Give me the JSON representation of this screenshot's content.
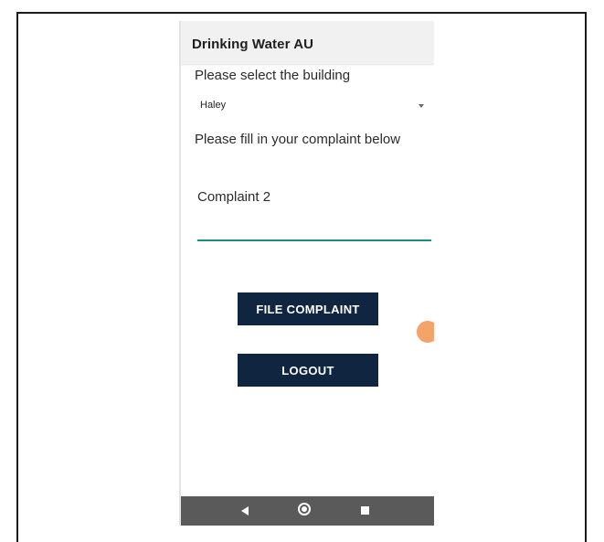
{
  "app": {
    "title": "Drinking Water AU"
  },
  "form": {
    "building_prompt": "Please select the building",
    "building_selected": "Haley",
    "complaint_prompt": "Please fill in your complaint below",
    "complaint_value": "Complaint 2"
  },
  "actions": {
    "file_complaint_label": "FILE COMPLAINT",
    "logout_label": "LOGOUT"
  },
  "colors": {
    "button_bg": "#0f2540",
    "input_underline": "#1c8a86",
    "fab": "#f4a36a",
    "nav_bar": "#5a5a5a"
  },
  "icons": {
    "nav_back": "back-triangle-icon",
    "nav_home": "home-circle-icon",
    "nav_recents": "recents-square-icon",
    "dropdown": "caret-down-icon"
  }
}
